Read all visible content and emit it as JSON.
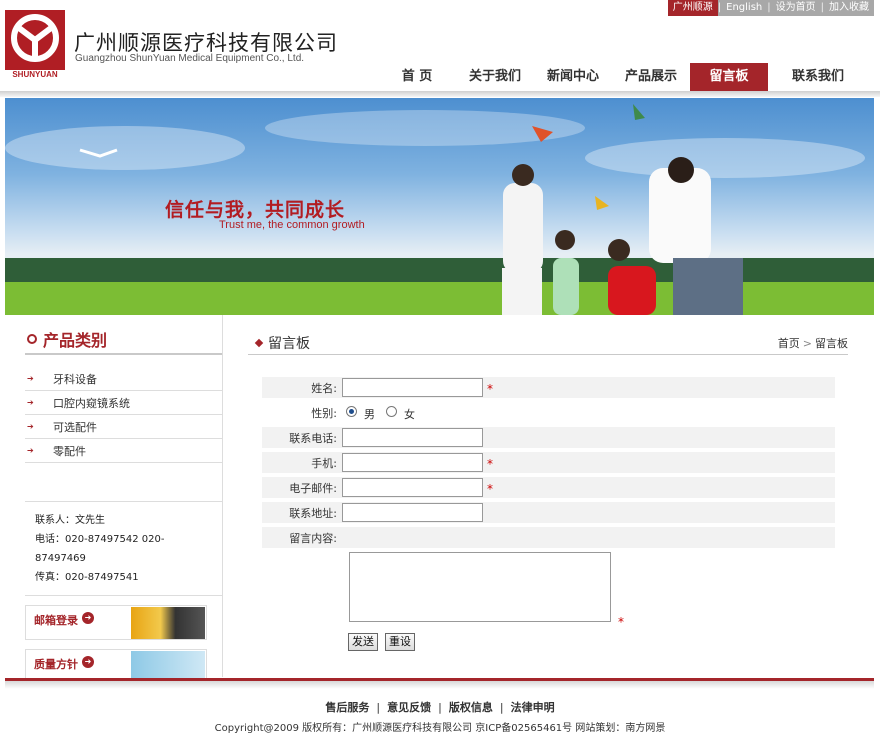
{
  "topbar": {
    "site_name": "广州顺源",
    "english": "English",
    "set_home": "设为首页",
    "bookmark": "加入收藏"
  },
  "header": {
    "logo_text": "SHUNYUAN",
    "company_cn": "广州顺源医疗科技有限公司",
    "company_en": "Guangzhou ShunYuan Medical Equipment Co., Ltd."
  },
  "nav": {
    "home": "首 页",
    "about": "关于我们",
    "news": "新闻中心",
    "products": "产品展示",
    "guestbook": "留言板",
    "contact": "联系我们",
    "active": "留言板"
  },
  "banner": {
    "slogan_cn": "信任与我，共同成长",
    "slogan_en": "Trust me, the common growth"
  },
  "sidebar": {
    "title": "产品类别",
    "categories": [
      {
        "label": "牙科设备"
      },
      {
        "label": "口腔内窥镜系统"
      },
      {
        "label": "可选配件"
      },
      {
        "label": "零配件"
      }
    ],
    "contact_person": "联系人：文先生",
    "phone": "电话：020-87497542 020-87497469",
    "fax": "传真：020-87497541",
    "promo_mail": "邮箱登录",
    "promo_quality": "质量方针"
  },
  "main": {
    "title": "留言板",
    "breadcrumb_home": "首页",
    "breadcrumb_current": "留言板"
  },
  "form": {
    "name_label": "姓名:",
    "gender_label": "性别:",
    "gender_male": "男",
    "gender_female": "女",
    "gender_selected": "男",
    "phone_label": "联系电话:",
    "mobile_label": "手机:",
    "email_label": "电子邮件:",
    "address_label": "联系地址:",
    "message_label": "留言内容:",
    "required_mark": "*",
    "submit_label": "发送",
    "reset_label": "重设",
    "name_value": "",
    "phone_value": "",
    "mobile_value": "",
    "email_value": "",
    "address_value": "",
    "message_value": ""
  },
  "footer": {
    "links": [
      "售后服务",
      "意见反馈",
      "版权信息",
      "法律申明"
    ],
    "copyright": "Copyright@2009 版权所有：广州顺源医疗科技有限公司 京ICP备02565461号 网站策划：南方网景"
  },
  "colors": {
    "brand": "#a4252a",
    "required": "#cc0000"
  }
}
